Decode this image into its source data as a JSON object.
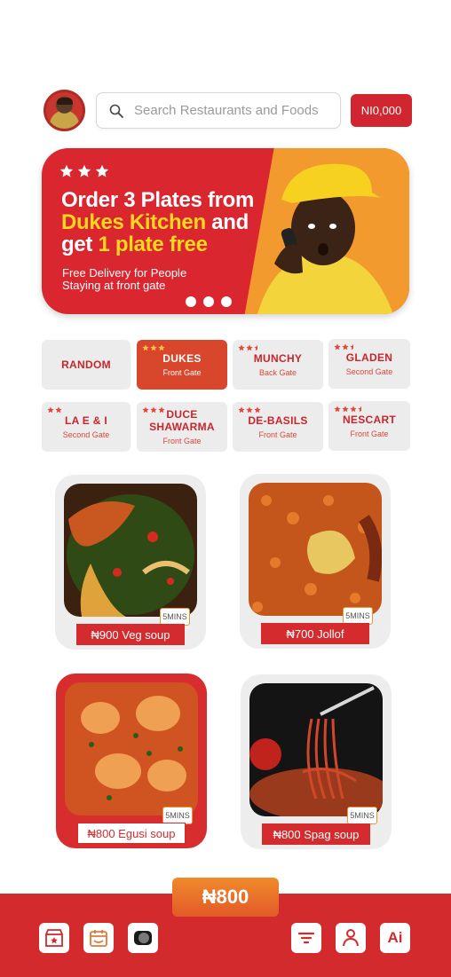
{
  "header": {
    "search_placeholder": "Search Restaurants and Foods",
    "wallet_balance": "NI0,000"
  },
  "banner": {
    "star_count": 3,
    "headline_1": "Order 3 Plates from",
    "headline_brand": "Dukes Kitchen",
    "headline_2": "and",
    "headline_3": "get",
    "headline_offer": "1 plate free",
    "subtext": "Free Delivery for People Staying at front gate",
    "pagination_dots": 3
  },
  "restaurants": [
    {
      "name": "RANDOM",
      "gate": "",
      "stars": 0,
      "active": false
    },
    {
      "name": "DUKES",
      "gate": "Front Gate",
      "stars": 3,
      "active": true
    },
    {
      "name": "MUNCHY",
      "gate": "Back Gate",
      "stars": 2.5,
      "active": false
    },
    {
      "name": "GLADEN",
      "gate": "Second Gate",
      "stars": 2.5,
      "active": false
    },
    {
      "name": "LA E & I",
      "gate": "Second Gate",
      "stars": 2,
      "active": false
    },
    {
      "name": "DUCE SHAWARMA",
      "gate": "Front Gate",
      "stars": 3,
      "active": false
    },
    {
      "name": "DE-BASILS",
      "gate": "Front Gate",
      "stars": 3,
      "active": false
    },
    {
      "name": "NESCART",
      "gate": "Front Gate",
      "stars": 3.5,
      "active": false
    }
  ],
  "foods": [
    {
      "label": "₦900 Veg soup",
      "time": "5MINS",
      "image": "veg-soup-image",
      "selected": false
    },
    {
      "label": "₦700 Jollof",
      "time": "5MINS",
      "image": "jollof-rice-image",
      "selected": false
    },
    {
      "label": "₦800 Egusi soup",
      "time": "5MINS",
      "image": "egusi-soup-image",
      "selected": true
    },
    {
      "label": "₦800 Spag soup",
      "time": "5MINS",
      "image": "spaghetti-image",
      "selected": false
    }
  ],
  "cart_total": "₦800",
  "nav": [
    {
      "icon": "store-icon"
    },
    {
      "icon": "calendar-icon"
    },
    {
      "icon": "toggle-icon"
    },
    {
      "icon": "filter-icon"
    },
    {
      "icon": "profile-icon"
    },
    {
      "icon": "ai-icon",
      "label": "Ai"
    }
  ],
  "colors": {
    "brand_red": "#d32a2d",
    "accent_orange": "#f29a2e",
    "highlight_yellow": "#ffd61f"
  }
}
